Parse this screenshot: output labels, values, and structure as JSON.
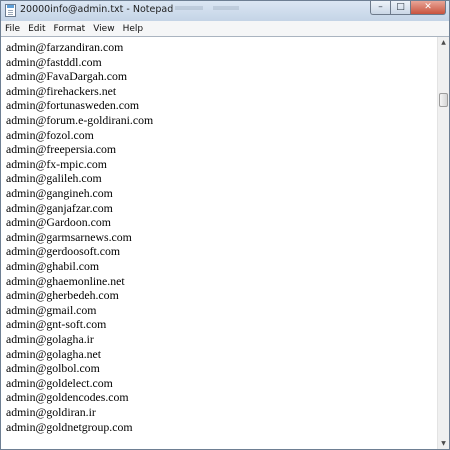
{
  "window": {
    "title": "20000info@admin.txt - Notepad",
    "minimize_glyph": "–",
    "maximize_glyph": "□",
    "close_glyph": "✕"
  },
  "menu": {
    "items": [
      "File",
      "Edit",
      "Format",
      "View",
      "Help"
    ]
  },
  "document": {
    "lines": [
      "admin@farzandiran.com",
      "admin@fastddl.com",
      "admin@FavaDargah.com",
      "admin@firehackers.net",
      "admin@fortunasweden.com",
      "admin@forum.e-goldirani.com",
      "admin@fozol.com",
      "admin@freepersia.com",
      "admin@fx-mpic.com",
      "admin@galileh.com",
      "admin@gangineh.com",
      "admin@ganjafzar.com",
      "admin@Gardoon.com",
      "admin@garmsarnews.com",
      "admin@gerdoosoft.com",
      "admin@ghabil.com",
      "admin@ghaemonline.net",
      "admin@gherbedeh.com",
      "admin@gmail.com",
      "admin@gnt-soft.com",
      "admin@golagha.ir",
      "admin@golagha.net",
      "admin@golbol.com",
      "admin@goldelect.com",
      "admin@goldencodes.com",
      "admin@goldiran.ir",
      "admin@goldnetgroup.com"
    ]
  },
  "scrollbar": {
    "up_glyph": "▲",
    "down_glyph": "▼",
    "position": 0.12
  },
  "colors": {
    "title_bar": "#cfdcea",
    "close_button": "#c8533e",
    "text": "#000000"
  }
}
